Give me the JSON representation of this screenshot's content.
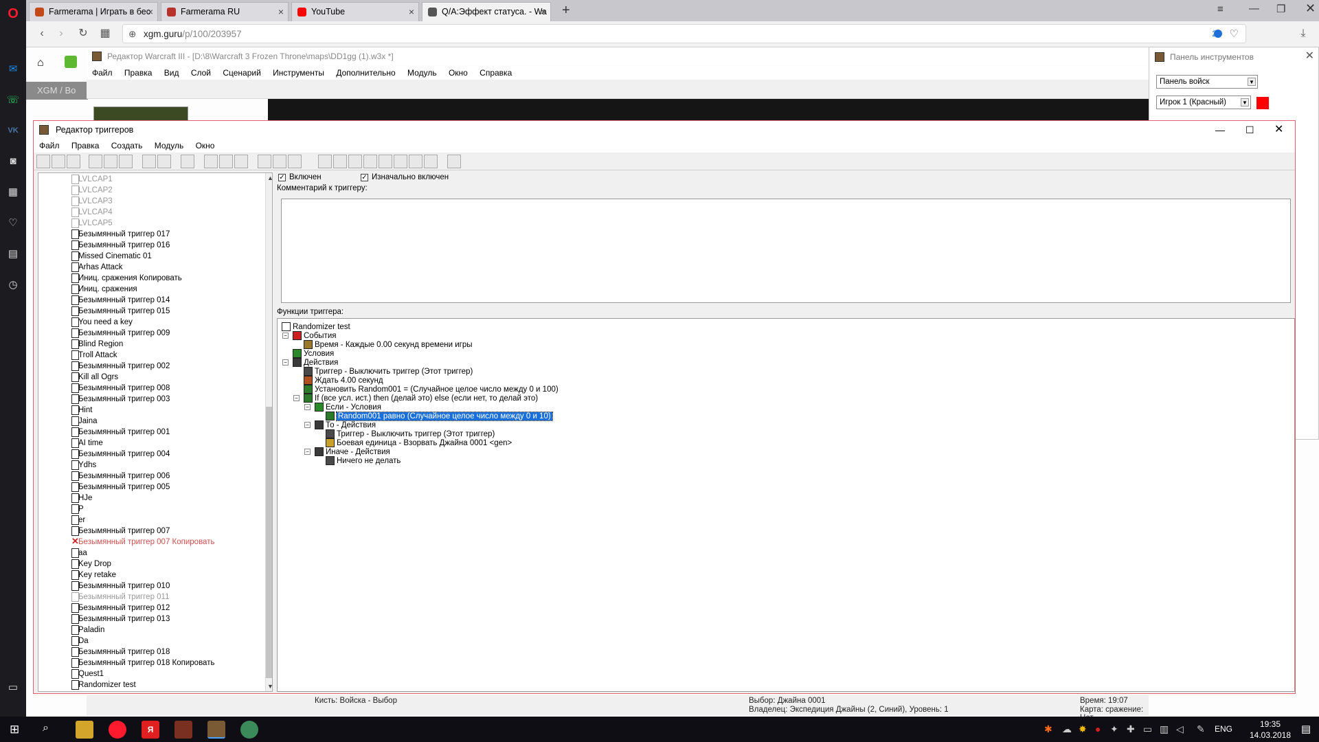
{
  "browser": {
    "tabs": [
      {
        "label": "Farmerama | Играть в бес",
        "color": "#c24a18"
      },
      {
        "label": "Farmerama RU",
        "color": "#b8322c"
      },
      {
        "label": "YouTube",
        "color": "#ff0000"
      },
      {
        "label": "Q/A:Эффект статуса. - Wa",
        "color": "#555555"
      }
    ],
    "new_tab": "+",
    "url_host": "xgm.guru",
    "url_path": "/p/100/203957",
    "badge": "2"
  },
  "editor": {
    "title": "Редактор Warcraft III  - [D:\\8\\Warcraft 3 Frozen Throne\\maps\\DD1gg (1).w3x *]",
    "menu": [
      "Файл",
      "Правка",
      "Вид",
      "Слой",
      "Сценарий",
      "Инструменты",
      "Дополнительно",
      "Модуль",
      "Окно",
      "Справка"
    ]
  },
  "toolpanel": {
    "title": "Панель инструментов",
    "palette": "Панель войск",
    "player": "Игрок 1 (Красный)",
    "player_color": "#ff0000"
  },
  "trigger_editor": {
    "title": "Редактор триггеров",
    "menu": [
      "Файл",
      "Правка",
      "Создать",
      "Модуль",
      "Окно"
    ],
    "enabled_label": "Включен",
    "initially_on_label": "Изначально включен",
    "comment_label": "Комментарий к триггеру:",
    "functions_label": "Функции триггера:",
    "tree": [
      {
        "label": "LVLCAP1",
        "state": "dim"
      },
      {
        "label": "LVLCAP2",
        "state": "dim"
      },
      {
        "label": "LVLCAP3",
        "state": "dim"
      },
      {
        "label": "LVLCAP4",
        "state": "dim"
      },
      {
        "label": "LVLCAP5",
        "state": "dim"
      },
      {
        "label": "Безымянный триггер 017",
        "state": "normal"
      },
      {
        "label": "Безымянный триггер 016",
        "state": "normal"
      },
      {
        "label": "Missed Cinematic 01",
        "state": "normal"
      },
      {
        "label": "Arhas Attack",
        "state": "normal"
      },
      {
        "label": "Иниц. сражения Копировать",
        "state": "normal"
      },
      {
        "label": "Иниц. сражения",
        "state": "normal"
      },
      {
        "label": "Безымянный триггер 014",
        "state": "normal"
      },
      {
        "label": "Безымянный триггер 015",
        "state": "normal"
      },
      {
        "label": "You need a key",
        "state": "normal"
      },
      {
        "label": "Безымянный триггер 009",
        "state": "normal"
      },
      {
        "label": "Blind Region",
        "state": "normal"
      },
      {
        "label": "Troll Attack",
        "state": "normal"
      },
      {
        "label": "Безымянный триггер 002",
        "state": "normal"
      },
      {
        "label": "Kill all Ogrs",
        "state": "normal"
      },
      {
        "label": "Безымянный триггер 008",
        "state": "normal"
      },
      {
        "label": "Безымянный триггер 003",
        "state": "normal"
      },
      {
        "label": "Hint",
        "state": "normal"
      },
      {
        "label": "Jaina",
        "state": "normal"
      },
      {
        "label": "Безымянный триггер 001",
        "state": "normal"
      },
      {
        "label": "AI time",
        "state": "normal"
      },
      {
        "label": "Безымянный триггер 004",
        "state": "normal"
      },
      {
        "label": "Ydhs",
        "state": "normal"
      },
      {
        "label": "Безымянный триггер 006",
        "state": "normal"
      },
      {
        "label": "Безымянный триггер 005",
        "state": "normal"
      },
      {
        "label": "HJe",
        "state": "normal"
      },
      {
        "label": "P",
        "state": "normal"
      },
      {
        "label": "er",
        "state": "normal"
      },
      {
        "label": "Безымянный триггер 007",
        "state": "normal"
      },
      {
        "label": "Безымянный триггер 007 Копировать",
        "state": "err"
      },
      {
        "label": "aa",
        "state": "normal"
      },
      {
        "label": "Key Drop",
        "state": "normal"
      },
      {
        "label": "Key retake",
        "state": "normal"
      },
      {
        "label": "Безымянный триггер 010",
        "state": "normal"
      },
      {
        "label": "Безымянный триггер 011",
        "state": "dim"
      },
      {
        "label": "Безымянный триггер 012",
        "state": "normal"
      },
      {
        "label": "Безымянный триггер 013",
        "state": "normal"
      },
      {
        "label": "Paladin",
        "state": "normal"
      },
      {
        "label": "Da",
        "state": "normal"
      },
      {
        "label": "Безымянный триггер 018",
        "state": "normal"
      },
      {
        "label": "Безымянный триггер 018 Копировать",
        "state": "normal"
      },
      {
        "label": "Quest1",
        "state": "normal"
      },
      {
        "label": "Randomizer test",
        "state": "normal"
      }
    ],
    "functions": [
      {
        "label": "Randomizer test",
        "level": 0,
        "icon": "page",
        "expand": ""
      },
      {
        "label": "События",
        "level": 1,
        "icon": "flag",
        "expand": "−"
      },
      {
        "label": "Время - Каждые 0.00 секунд времени игры",
        "level": 2,
        "icon": "clock",
        "expand": ""
      },
      {
        "label": "Условия",
        "level": 1,
        "icon": "cond",
        "expand": ""
      },
      {
        "label": "Действия",
        "level": 1,
        "icon": "act",
        "expand": "−"
      },
      {
        "label": "Триггер - Выключить триггер (Этот триггер)",
        "level": 2,
        "icon": "gear",
        "expand": ""
      },
      {
        "label": "Ждать 4.00 секунд",
        "level": 2,
        "icon": "hourglass",
        "expand": ""
      },
      {
        "label": "Установить Random001 = (Случайное целое число между 0 и 100)",
        "level": 2,
        "icon": "var",
        "expand": ""
      },
      {
        "label": "If (все усл. ист.) then (делай это) else (если нет, то делай это)",
        "level": 2,
        "icon": "if",
        "expand": "−"
      },
      {
        "label": "Если - Условия",
        "level": 3,
        "icon": "cond",
        "expand": "−"
      },
      {
        "label": "Random001 равно (Случайное целое число между 0 и 10)",
        "level": 4,
        "icon": "if",
        "expand": "",
        "selected": true
      },
      {
        "label": "То - Действия",
        "level": 3,
        "icon": "act",
        "expand": "−"
      },
      {
        "label": "Триггер - Выключить триггер (Этот триггер)",
        "level": 4,
        "icon": "gear",
        "expand": ""
      },
      {
        "label": "Боевая единица - Взорвать Джайна 0001 <gen>",
        "level": 4,
        "icon": "unit",
        "expand": ""
      },
      {
        "label": "Иначе - Действия",
        "level": 3,
        "icon": "act",
        "expand": "−"
      },
      {
        "label": "Ничего не делать",
        "level": 4,
        "icon": "gear",
        "expand": ""
      }
    ]
  },
  "status": {
    "brush": "Кисть: Войска - Выбор",
    "selection": "Выбор: Джайна 0001",
    "owner": "Владелец: Экспедиция Джайны (2, Синий), Уровень: 1",
    "time": "Время: 19:07",
    "map": "Карта: сражение: Нет"
  },
  "taskbar": {
    "lang": "ENG",
    "time": "19:35",
    "date": "14.03.2018"
  },
  "page": {
    "site_nav": "XGM",
    "site_nav2": "Bo"
  }
}
